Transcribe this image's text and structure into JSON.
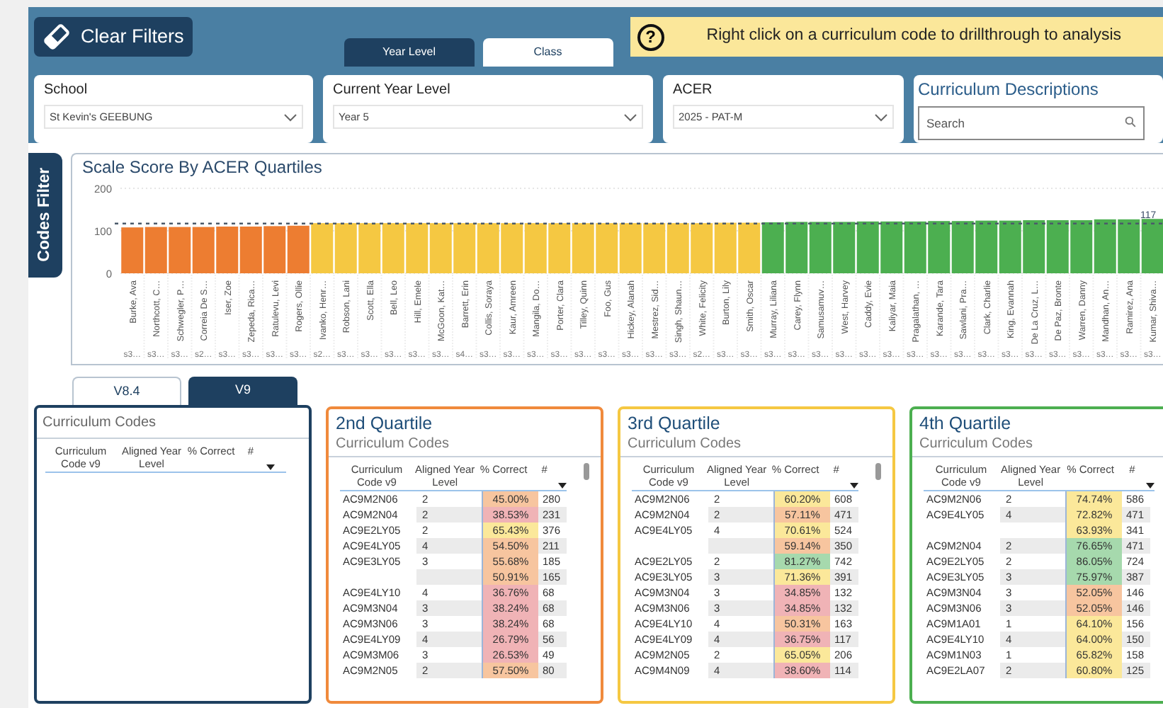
{
  "header": {
    "clear_button": "Clear Filters",
    "view_tabs": [
      {
        "label": "Year Level",
        "selected": true
      },
      {
        "label": "Class",
        "selected": false
      }
    ],
    "banner": {
      "icon_text": "?",
      "text": "Right click on a curriculum code to drillthrough to analysis"
    },
    "filters": [
      {
        "label": "School",
        "value": "St Kevin's GEEBUNG"
      },
      {
        "label": "Current Year Level",
        "value": "Year 5"
      },
      {
        "label": "ACER",
        "value": "2025 - PAT-M"
      }
    ],
    "descriptions": {
      "title": "Curriculum Descriptions",
      "placeholder": "Search"
    }
  },
  "side_tab": "Codes Filter",
  "chart": {
    "chart_data": {
      "type": "bar",
      "title": "Scale Score By ACER Quartiles",
      "categories": [
        "Burke, Ava",
        "Northcott, C…",
        "Schwegler, P…",
        "Correia De S…",
        "Iser, Zoe",
        "Zepeda, Rica…",
        "Ratulevu, Levi",
        "Rogers, Ollie",
        "Ivanko, Henr…",
        "Robson, Lani",
        "Scott, Ella",
        "Bell, Leo",
        "Hill, Emele",
        "McGoon, Kat…",
        "Barrett, Erin",
        "Collis, Soraya",
        "Kaur, Amreen",
        "Mangila, Do…",
        "Porter, Clara",
        "Tilley, Quinn",
        "Foo, Gus",
        "Hickey, Alanah",
        "Mestrez, Sid…",
        "Singh, Shaun…",
        "White, Felicity",
        "Burton, Lily",
        "Smith, Oscar",
        "Murray, Liliana",
        "Carey, Flynn",
        "Samusamuv…",
        "West, Harvey",
        "Caddy, Evie",
        "Kaliyar, Maia",
        "Pragalathan, …",
        "Karande, Tara",
        "Sawlani, Pra…",
        "Clark, Charlie",
        "King, Evannah",
        "De La Cruz, L…",
        "De Paz, Bronte",
        "Warren, Danny",
        "Mandhan, An…",
        "Ramirez, Ana",
        "Kumar, Shiva…"
      ],
      "series": [
        {
          "color": "#ed7d31",
          "values": [
            108,
            109,
            109,
            109,
            110,
            110,
            111,
            112,
            null,
            null,
            null,
            null,
            null,
            null,
            null,
            null,
            null,
            null,
            null,
            null,
            null,
            null,
            null,
            null,
            null,
            null,
            null,
            null,
            null,
            null,
            null,
            null,
            null,
            null,
            null,
            null,
            null,
            null,
            null,
            null,
            null,
            null,
            null,
            null
          ]
        },
        {
          "color": "#f5c842",
          "values": [
            null,
            null,
            null,
            null,
            null,
            null,
            null,
            null,
            118,
            118,
            118,
            118,
            118,
            118,
            118,
            118,
            118,
            118,
            118,
            118,
            118,
            118,
            118,
            118,
            118,
            119,
            119,
            null,
            null,
            null,
            null,
            null,
            null,
            null,
            null,
            null,
            null,
            null,
            null,
            null,
            null,
            null,
            null,
            null
          ]
        },
        {
          "color": "#4caf50",
          "values": [
            null,
            null,
            null,
            null,
            null,
            null,
            null,
            null,
            null,
            null,
            null,
            null,
            null,
            null,
            null,
            null,
            null,
            null,
            null,
            null,
            null,
            null,
            null,
            null,
            null,
            null,
            null,
            120,
            121,
            121,
            121,
            122,
            122,
            122,
            123,
            123,
            124,
            124,
            125,
            125,
            125,
            127,
            127,
            128
          ]
        }
      ],
      "yticks": [
        0,
        100,
        200
      ],
      "ylim": [
        0,
        200
      ],
      "ref_lines": [
        {
          "axis": "y",
          "value": 117,
          "label": "117"
        }
      ]
    },
    "group_labels": [
      "s3…",
      "s3…",
      "s3…",
      "s2…",
      "s3…",
      "s3…",
      "s3…",
      "s3…",
      "s2…",
      "s3…",
      "s3…",
      "s3…",
      "s3…",
      "s3…",
      "s4…",
      "s3…",
      "s3…",
      "s3…",
      "s3…",
      "s3…",
      "s3…",
      "s3…",
      "s3…",
      "s3…",
      "s2…",
      "s3…",
      "s3…",
      "s3…",
      "s3…",
      "s3…",
      "s3…",
      "s3…",
      "s3…",
      "s3…",
      "s3…",
      "s3…",
      "s3…",
      "s3…",
      "s3…",
      "s3…",
      "s3…",
      "s3…",
      "s3…",
      "s3…"
    ]
  },
  "version_tabs": [
    {
      "label": "V8.4",
      "selected": false
    },
    {
      "label": "V9",
      "selected": true
    }
  ],
  "codes_panel": {
    "title": "Curriculum Codes",
    "columns": [
      "Curriculum Code v9",
      "Aligned Year Level",
      "% Correct",
      "#"
    ]
  },
  "quartiles": [
    {
      "title": "2nd Quartile",
      "subtitle": "Curriculum Codes",
      "color": "#f08a3c",
      "columns": [
        "Curriculum Code v9",
        "Aligned Year Level",
        "% Correct",
        "#"
      ],
      "rows": [
        {
          "code": "AC9M2N06",
          "level": "2",
          "pct": "45.00%",
          "count": "280",
          "color": "#f7c59f"
        },
        {
          "code": "AC9M2N04",
          "level": "2",
          "pct": "38.53%",
          "count": "231",
          "color": "#f0b3b6"
        },
        {
          "code": "AC9E2LY05",
          "level": "2",
          "pct": "65.43%",
          "count": "376",
          "color": "#fbe89a"
        },
        {
          "code": "AC9E4LY05",
          "level": "4",
          "pct": "54.50%",
          "count": "211",
          "color": "#f7c59f"
        },
        {
          "code": "AC9E3LY05",
          "level": "3",
          "pct": "55.68%",
          "count": "185",
          "color": "#f7c59f"
        },
        {
          "pct": "50.91%",
          "count": "165",
          "color": "#f7c59f"
        },
        {
          "code": "AC9E4LY10",
          "level": "4",
          "pct": "36.76%",
          "count": "68",
          "color": "#f0b3b6"
        },
        {
          "code": "AC9M3N04",
          "level": "3",
          "pct": "38.24%",
          "count": "68",
          "color": "#f0b3b6"
        },
        {
          "code": "AC9M3N06",
          "level": "3",
          "pct": "38.24%",
          "count": "68",
          "color": "#f0b3b6"
        },
        {
          "code": "AC9E4LY09",
          "level": "4",
          "pct": "26.79%",
          "count": "56",
          "color": "#f0b3b6"
        },
        {
          "code": "AC9M3M06",
          "level": "3",
          "pct": "26.53%",
          "count": "49",
          "color": "#f0b3b6"
        },
        {
          "code": "AC9M2N05",
          "level": "2",
          "pct": "57.50%",
          "count": "80",
          "color": "#f7c59f"
        }
      ]
    },
    {
      "title": "3rd Quartile",
      "subtitle": "Curriculum Codes",
      "color": "#f5c842",
      "columns": [
        "Curriculum Code v9",
        "Aligned Year Level",
        "% Correct",
        "#"
      ],
      "rows": [
        {
          "code": "AC9M2N06",
          "level": "2",
          "pct": "60.20%",
          "count": "608",
          "color": "#fbe89a"
        },
        {
          "code": "AC9M2N04",
          "level": "2",
          "pct": "57.11%",
          "count": "471",
          "color": "#f7c59f"
        },
        {
          "code": "AC9E4LY05",
          "level": "4",
          "pct": "70.61%",
          "count": "524",
          "color": "#fbe89a"
        },
        {
          "pct": "59.14%",
          "count": "350",
          "color": "#f7c59f"
        },
        {
          "code": "AC9E2LY05",
          "level": "2",
          "pct": "81.27%",
          "count": "742",
          "color": "#a6d9ad"
        },
        {
          "code": "AC9E3LY05",
          "level": "3",
          "pct": "71.36%",
          "count": "391",
          "color": "#fbe89a"
        },
        {
          "code": "AC9M3N04",
          "level": "3",
          "pct": "34.85%",
          "count": "132",
          "color": "#f0b3b6"
        },
        {
          "code": "AC9M3N06",
          "level": "3",
          "pct": "34.85%",
          "count": "132",
          "color": "#f0b3b6"
        },
        {
          "code": "AC9E4LY10",
          "level": "4",
          "pct": "50.31%",
          "count": "163",
          "color": "#f7c59f"
        },
        {
          "code": "AC9E4LY09",
          "level": "4",
          "pct": "36.75%",
          "count": "117",
          "color": "#f0b3b6"
        },
        {
          "code": "AC9M2N05",
          "level": "2",
          "pct": "65.05%",
          "count": "206",
          "color": "#fbe89a"
        },
        {
          "code": "AC9M4N09",
          "level": "4",
          "pct": "38.60%",
          "count": "114",
          "color": "#f0b3b6"
        }
      ]
    },
    {
      "title": "4th Quartile",
      "subtitle": "Curriculum Codes",
      "color": "#4caf50",
      "columns": [
        "Curriculum Code v9",
        "Aligned Year Level",
        "% Correct",
        "#"
      ],
      "rows": [
        {
          "code": "AC9M2N06",
          "level": "2",
          "pct": "74.74%",
          "count": "586",
          "color": "#fbe89a"
        },
        {
          "code": "AC9E4LY05",
          "level": "4",
          "pct": "72.82%",
          "count": "471",
          "color": "#fbe89a"
        },
        {
          "pct": "63.93%",
          "count": "341",
          "color": "#fbe89a"
        },
        {
          "code": "AC9M2N04",
          "level": "2",
          "pct": "76.65%",
          "count": "471",
          "color": "#a6d9ad"
        },
        {
          "code": "AC9E2LY05",
          "level": "2",
          "pct": "86.05%",
          "count": "724",
          "color": "#a6d9ad"
        },
        {
          "code": "AC9E3LY05",
          "level": "3",
          "pct": "75.97%",
          "count": "387",
          "color": "#a6d9ad"
        },
        {
          "code": "AC9M3N04",
          "level": "3",
          "pct": "52.05%",
          "count": "146",
          "color": "#f7c59f"
        },
        {
          "code": "AC9M3N06",
          "level": "3",
          "pct": "52.05%",
          "count": "146",
          "color": "#f7c59f"
        },
        {
          "code": "AC9M1A01",
          "level": "1",
          "pct": "64.10%",
          "count": "156",
          "color": "#fbe89a"
        },
        {
          "code": "AC9E4LY10",
          "level": "4",
          "pct": "64.00%",
          "count": "150",
          "color": "#fbe89a"
        },
        {
          "code": "AC9M1N03",
          "level": "1",
          "pct": "65.82%",
          "count": "158",
          "color": "#fbe89a"
        },
        {
          "code": "AC9E2LA07",
          "level": "2",
          "pct": "60.80%",
          "count": "125",
          "color": "#fbe89a"
        }
      ]
    }
  ]
}
